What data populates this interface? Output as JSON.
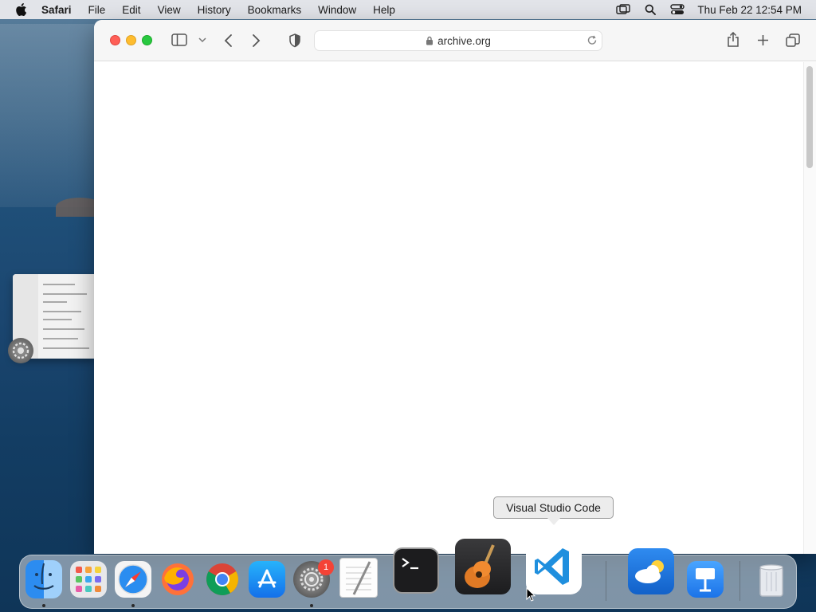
{
  "menubar": {
    "app_name": "Safari",
    "items": [
      "File",
      "Edit",
      "View",
      "History",
      "Bookmarks",
      "Window",
      "Help"
    ],
    "clock": "Thu Feb 22  12:54 PM"
  },
  "browser": {
    "url": "archive.org"
  },
  "tooltip": {
    "text": "Visual Studio Code"
  },
  "dock": {
    "apps": [
      "Finder",
      "Launchpad",
      "Safari",
      "Firefox",
      "Google Chrome",
      "App Store",
      "System Settings",
      "TextEdit",
      "Terminal",
      "GarageBand",
      "Visual Studio Code",
      "Weather",
      "Keynote",
      "Trash"
    ],
    "badge_count": "1"
  },
  "colors": {
    "close": "#ff5f57",
    "minimize": "#febc2e",
    "zoom": "#28c840",
    "vscode_blue": "#1f8fde",
    "badge": "#f44336"
  }
}
